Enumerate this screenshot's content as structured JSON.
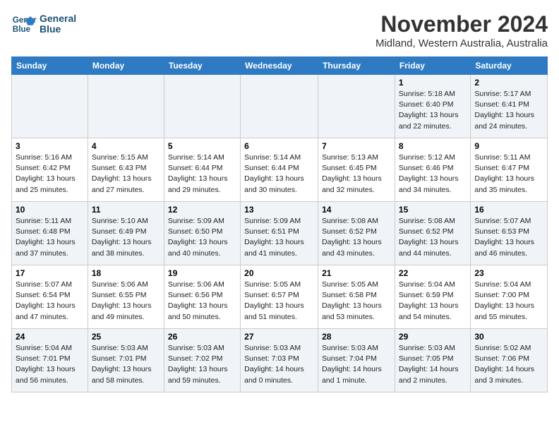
{
  "header": {
    "logo_line1": "General",
    "logo_line2": "Blue",
    "month_year": "November 2024",
    "location": "Midland, Western Australia, Australia"
  },
  "weekdays": [
    "Sunday",
    "Monday",
    "Tuesday",
    "Wednesday",
    "Thursday",
    "Friday",
    "Saturday"
  ],
  "weeks": [
    [
      {
        "day": "",
        "info": ""
      },
      {
        "day": "",
        "info": ""
      },
      {
        "day": "",
        "info": ""
      },
      {
        "day": "",
        "info": ""
      },
      {
        "day": "",
        "info": ""
      },
      {
        "day": "1",
        "info": "Sunrise: 5:18 AM\nSunset: 6:40 PM\nDaylight: 13 hours\nand 22 minutes."
      },
      {
        "day": "2",
        "info": "Sunrise: 5:17 AM\nSunset: 6:41 PM\nDaylight: 13 hours\nand 24 minutes."
      }
    ],
    [
      {
        "day": "3",
        "info": "Sunrise: 5:16 AM\nSunset: 6:42 PM\nDaylight: 13 hours\nand 25 minutes."
      },
      {
        "day": "4",
        "info": "Sunrise: 5:15 AM\nSunset: 6:43 PM\nDaylight: 13 hours\nand 27 minutes."
      },
      {
        "day": "5",
        "info": "Sunrise: 5:14 AM\nSunset: 6:44 PM\nDaylight: 13 hours\nand 29 minutes."
      },
      {
        "day": "6",
        "info": "Sunrise: 5:14 AM\nSunset: 6:44 PM\nDaylight: 13 hours\nand 30 minutes."
      },
      {
        "day": "7",
        "info": "Sunrise: 5:13 AM\nSunset: 6:45 PM\nDaylight: 13 hours\nand 32 minutes."
      },
      {
        "day": "8",
        "info": "Sunrise: 5:12 AM\nSunset: 6:46 PM\nDaylight: 13 hours\nand 34 minutes."
      },
      {
        "day": "9",
        "info": "Sunrise: 5:11 AM\nSunset: 6:47 PM\nDaylight: 13 hours\nand 35 minutes."
      }
    ],
    [
      {
        "day": "10",
        "info": "Sunrise: 5:11 AM\nSunset: 6:48 PM\nDaylight: 13 hours\nand 37 minutes."
      },
      {
        "day": "11",
        "info": "Sunrise: 5:10 AM\nSunset: 6:49 PM\nDaylight: 13 hours\nand 38 minutes."
      },
      {
        "day": "12",
        "info": "Sunrise: 5:09 AM\nSunset: 6:50 PM\nDaylight: 13 hours\nand 40 minutes."
      },
      {
        "day": "13",
        "info": "Sunrise: 5:09 AM\nSunset: 6:51 PM\nDaylight: 13 hours\nand 41 minutes."
      },
      {
        "day": "14",
        "info": "Sunrise: 5:08 AM\nSunset: 6:52 PM\nDaylight: 13 hours\nand 43 minutes."
      },
      {
        "day": "15",
        "info": "Sunrise: 5:08 AM\nSunset: 6:52 PM\nDaylight: 13 hours\nand 44 minutes."
      },
      {
        "day": "16",
        "info": "Sunrise: 5:07 AM\nSunset: 6:53 PM\nDaylight: 13 hours\nand 46 minutes."
      }
    ],
    [
      {
        "day": "17",
        "info": "Sunrise: 5:07 AM\nSunset: 6:54 PM\nDaylight: 13 hours\nand 47 minutes."
      },
      {
        "day": "18",
        "info": "Sunrise: 5:06 AM\nSunset: 6:55 PM\nDaylight: 13 hours\nand 49 minutes."
      },
      {
        "day": "19",
        "info": "Sunrise: 5:06 AM\nSunset: 6:56 PM\nDaylight: 13 hours\nand 50 minutes."
      },
      {
        "day": "20",
        "info": "Sunrise: 5:05 AM\nSunset: 6:57 PM\nDaylight: 13 hours\nand 51 minutes."
      },
      {
        "day": "21",
        "info": "Sunrise: 5:05 AM\nSunset: 6:58 PM\nDaylight: 13 hours\nand 53 minutes."
      },
      {
        "day": "22",
        "info": "Sunrise: 5:04 AM\nSunset: 6:59 PM\nDaylight: 13 hours\nand 54 minutes."
      },
      {
        "day": "23",
        "info": "Sunrise: 5:04 AM\nSunset: 7:00 PM\nDaylight: 13 hours\nand 55 minutes."
      }
    ],
    [
      {
        "day": "24",
        "info": "Sunrise: 5:04 AM\nSunset: 7:01 PM\nDaylight: 13 hours\nand 56 minutes."
      },
      {
        "day": "25",
        "info": "Sunrise: 5:03 AM\nSunset: 7:01 PM\nDaylight: 13 hours\nand 58 minutes."
      },
      {
        "day": "26",
        "info": "Sunrise: 5:03 AM\nSunset: 7:02 PM\nDaylight: 13 hours\nand 59 minutes."
      },
      {
        "day": "27",
        "info": "Sunrise: 5:03 AM\nSunset: 7:03 PM\nDaylight: 14 hours\nand 0 minutes."
      },
      {
        "day": "28",
        "info": "Sunrise: 5:03 AM\nSunset: 7:04 PM\nDaylight: 14 hours\nand 1 minute."
      },
      {
        "day": "29",
        "info": "Sunrise: 5:03 AM\nSunset: 7:05 PM\nDaylight: 14 hours\nand 2 minutes."
      },
      {
        "day": "30",
        "info": "Sunrise: 5:02 AM\nSunset: 7:06 PM\nDaylight: 14 hours\nand 3 minutes."
      }
    ]
  ]
}
